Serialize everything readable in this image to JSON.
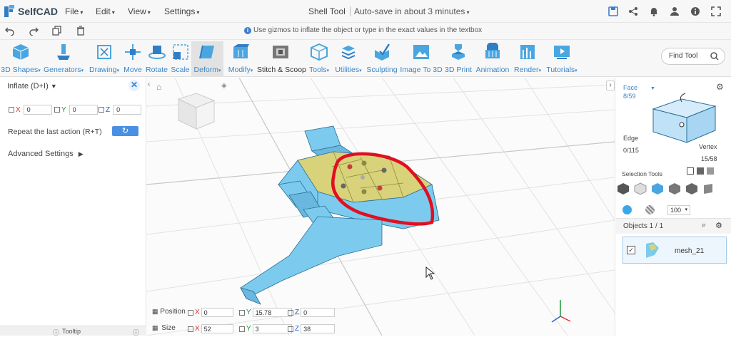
{
  "app": {
    "logo_text": "SelfCAD",
    "title": "Shell Tool",
    "autosave": "Auto-save in about 3 minutes"
  },
  "menus": [
    "File",
    "Edit",
    "View",
    "Settings"
  ],
  "hint": "Use gizmos to inflate the object or type in the exact values in the textbox",
  "toolbar": {
    "tools": [
      {
        "label": "3D Shapes",
        "icon": "cube-icon"
      },
      {
        "label": "Generators",
        "icon": "generator-icon"
      },
      {
        "label": "Drawing",
        "icon": "drawing-icon"
      },
      {
        "label": "Move",
        "icon": "move-icon"
      },
      {
        "label": "Rotate",
        "icon": "rotate-icon"
      },
      {
        "label": "Scale",
        "icon": "scale-icon"
      },
      {
        "label": "Deform",
        "icon": "deform-icon"
      },
      {
        "label": "Modify",
        "icon": "modify-icon"
      },
      {
        "label": "Stitch & Scoop",
        "icon": "stitch-scoop-icon"
      },
      {
        "label": "Tools",
        "icon": "tools-icon"
      },
      {
        "label": "Utilities",
        "icon": "utilities-icon"
      },
      {
        "label": "Sculpting",
        "icon": "sculpting-icon"
      },
      {
        "label": "Image To 3D",
        "icon": "image-to-3d-icon"
      },
      {
        "label": "3D Print",
        "icon": "3d-print-icon"
      },
      {
        "label": "Animation",
        "icon": "animation-icon"
      },
      {
        "label": "Render",
        "icon": "render-icon"
      },
      {
        "label": "Tutorials",
        "icon": "tutorials-icon"
      }
    ],
    "find_tool": "Find Tool"
  },
  "left_panel": {
    "title": "Inflate (D+I)",
    "x_label": "X",
    "x_value": "0",
    "y_label": "Y",
    "y_value": "0",
    "z_label": "Z",
    "z_value": "0",
    "repeat_label": "Repeat the last action (R+T)",
    "advanced": "Advanced Settings",
    "tooltip": "Tooltip"
  },
  "right_panel": {
    "mode": "Face",
    "face_count": "8/59",
    "edge_label": "Edge",
    "edge_count": "0/115",
    "vertex_label": "Vertex",
    "vertex_count": "15/58",
    "selection_tools": "Selection Tools",
    "size_value": "100",
    "objects_header": "Objects 1 / 1",
    "object_name": "mesh_21"
  },
  "transform": {
    "position_label": "Position",
    "size_label": "Size",
    "pos_x": "0",
    "pos_y": "15.78",
    "pos_z": "0",
    "size_x": "52",
    "size_y": "3",
    "size_z": "38",
    "x": "X",
    "y": "Y",
    "z": "Z"
  },
  "colors": {
    "accent": "#3a86c8",
    "mesh": "#7ccbef",
    "selected_face": "#d8d27a",
    "annotation": "#e01020"
  }
}
